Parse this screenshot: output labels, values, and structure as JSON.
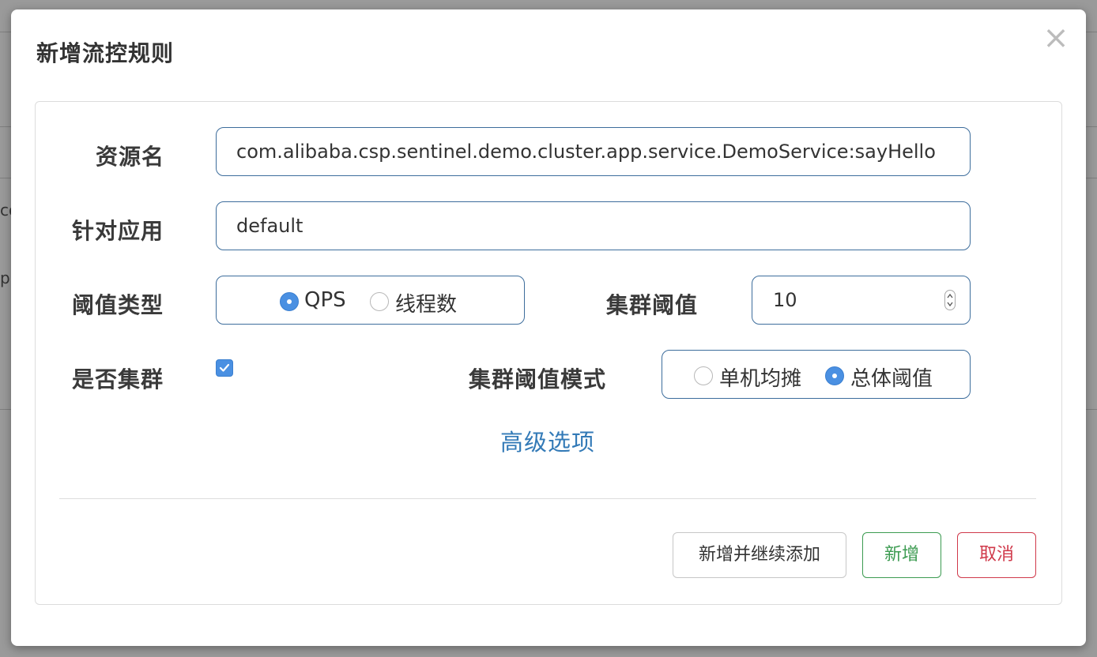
{
  "background": {
    "fragment_1": "co",
    "fragment_2": "p."
  },
  "modal": {
    "title": "新增流控规则",
    "close_glyph": "×"
  },
  "form": {
    "resource_label": "资源名",
    "resource_value": "com.alibaba.csp.sentinel.demo.cluster.app.service.DemoService:sayHello",
    "app_label": "针对应用",
    "app_value": "default",
    "threshold_type_label": "阈值类型",
    "threshold_type_options": [
      {
        "label": "QPS",
        "selected": true
      },
      {
        "label": "线程数",
        "selected": false
      }
    ],
    "cluster_threshold_label": "集群阈值",
    "cluster_threshold_value": "10",
    "is_cluster_label": "是否集群",
    "is_cluster_checked": true,
    "cluster_mode_label": "集群阈值模式",
    "cluster_mode_options": [
      {
        "label": "单机均摊",
        "selected": false
      },
      {
        "label": "总体阈值",
        "selected": true
      }
    ],
    "advanced_link": "高级选项"
  },
  "footer": {
    "add_continue_label": "新增并继续添加",
    "add_label": "新增",
    "cancel_label": "取消"
  },
  "colors": {
    "accent": "#4a90e2",
    "field_border": "#3d6d9c",
    "link": "#337ab7",
    "success": "#3c9b51",
    "danger": "#d0394a"
  },
  "icons": {
    "close": "close-icon",
    "checkbox": "checkmark-icon",
    "spinner": "spinner-arrows-icon"
  }
}
